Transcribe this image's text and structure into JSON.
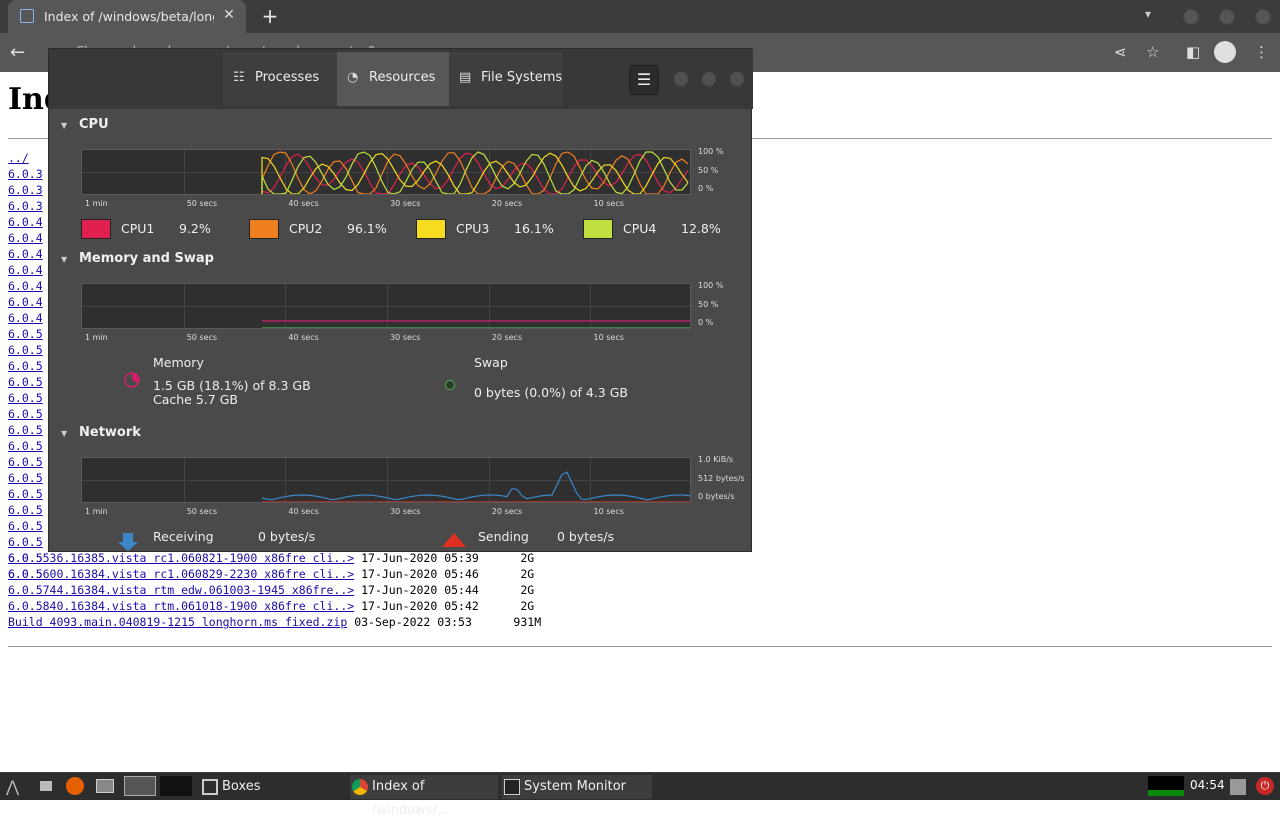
{
  "browser": {
    "tab_title": "Index of /windows/beta/longho",
    "close_glyph": "✕",
    "new_tab_glyph": "+",
    "omnibox_text": "… Chr … …d … …l …c … …/ … …/ … …hor … …/ …0 …"
  },
  "page": {
    "heading": "Ind",
    "parent_link": "../",
    "partial_links": [
      "6.0.3",
      "6.0.3",
      "6.0.3",
      "6.0.4",
      "6.0.4",
      "6.0.4",
      "6.0.4",
      "6.0.4",
      "6.0.4",
      "6.0.4",
      "6.0.5",
      "6.0.5",
      "6.0.5",
      "6.0.5",
      "6.0.5",
      "6.0.5",
      "6.0.5",
      "6.0.5",
      "6.0.5",
      "6.0.5",
      "6.0.5",
      "6.0.5",
      "6.0.5",
      "6.0.5",
      "6.0.5",
      "6.0.5"
    ],
    "rows": [
      {
        "name": "6.0.5536.16385.vista rc1.060821-1900 x86fre cli..>",
        "date": "17-Jun-2020 05:39",
        "size": "2G"
      },
      {
        "name": "6.0.5600.16384.vista rc1.060829-2230 x86fre cli..>",
        "date": "17-Jun-2020 05:46",
        "size": "2G"
      },
      {
        "name": "6.0.5744.16384.vista rtm edw.061003-1945 x86fre..>",
        "date": "17-Jun-2020 05:44",
        "size": "2G"
      },
      {
        "name": "6.0.5840.16384.vista rtm.061018-1900 x86fre cli..>",
        "date": "17-Jun-2020 05:42",
        "size": "2G"
      },
      {
        "name": "Build 4093.main.040819-1215 longhorn.ms fixed.zip",
        "date": "03-Sep-2022 03:53",
        "size": "931M"
      }
    ]
  },
  "sysmon": {
    "tabs": [
      {
        "label": "Processes",
        "icon": "list-icon"
      },
      {
        "label": "Resources",
        "icon": "gauge-icon"
      },
      {
        "label": "File Systems",
        "icon": "disk-icon"
      }
    ],
    "active_tab": "Resources",
    "menu_glyph": "☰",
    "x_ticks": [
      "1 min",
      "50 secs",
      "40 secs",
      "30 secs",
      "20 secs",
      "10 secs"
    ],
    "pct_ticks": [
      "100 %",
      "50 %",
      "0 %"
    ],
    "cpu": {
      "title": "CPU",
      "cores": [
        {
          "name": "CPU1",
          "value": "9.2%",
          "color": "#e0204f"
        },
        {
          "name": "CPU2",
          "value": "96.1%",
          "color": "#f07f20"
        },
        {
          "name": "CPU3",
          "value": "16.1%",
          "color": "#f5dc1e"
        },
        {
          "name": "CPU4",
          "value": "12.8%",
          "color": "#c0e040"
        }
      ]
    },
    "memory": {
      "title": "Memory and Swap",
      "memory_label": "Memory",
      "memory_value": "1.5 GB (18.1%) of 8.3 GB",
      "cache_value": "Cache 5.7 GB",
      "memory_color": "#d0206a",
      "swap_label": "Swap",
      "swap_value": "0 bytes (0.0%) of 4.3 GB",
      "swap_color": "#4caf50"
    },
    "network": {
      "title": "Network",
      "y_ticks": [
        "1.0 KiB/s",
        "512 bytes/s",
        "0 bytes/s"
      ],
      "receiving_label": "Receiving",
      "receiving_value": "0 bytes/s",
      "receiving_color": "#3b87c8",
      "sending_label": "Sending",
      "sending_value": "0 bytes/s",
      "sending_color": "#e03020"
    }
  },
  "taskbar": {
    "tasks": [
      {
        "label": "Boxes",
        "icon": "boxes-icon"
      },
      {
        "label": "Index of /windows/...",
        "icon": "chrome-icon"
      },
      {
        "label": "System Monitor",
        "icon": "monitor-icon"
      }
    ],
    "clock": "04:54"
  }
}
